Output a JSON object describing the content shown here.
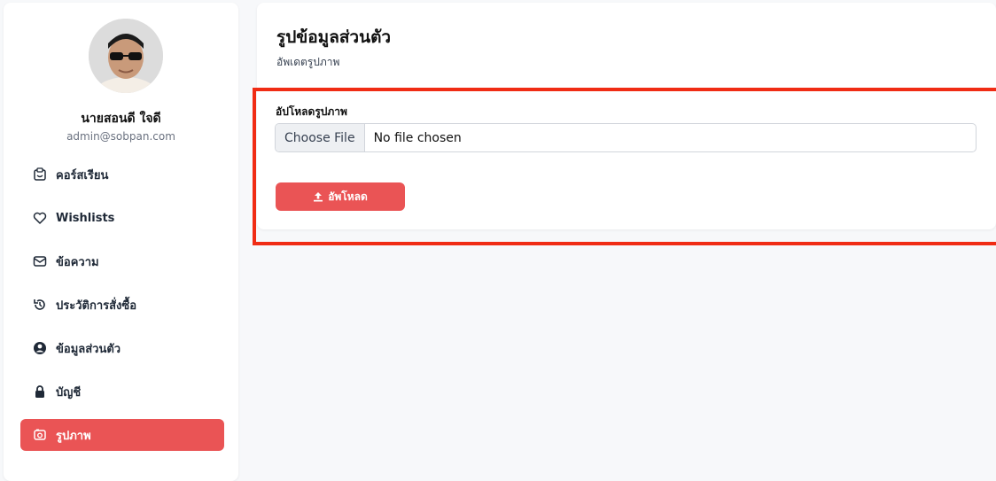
{
  "sidebar": {
    "user_name": "นายสอนดี ใจดี",
    "user_email": "admin@sobpan.com",
    "items": [
      {
        "label": "คอร์สเรียน",
        "icon": "course-icon"
      },
      {
        "label": "Wishlists",
        "icon": "heart-icon"
      },
      {
        "label": "ข้อความ",
        "icon": "message-icon"
      },
      {
        "label": "ประวัติการสั่งซื้อ",
        "icon": "history-icon"
      },
      {
        "label": "ข้อมูลส่วนตัว",
        "icon": "user-circle-icon"
      },
      {
        "label": "บัญชี",
        "icon": "lock-icon"
      },
      {
        "label": "รูปภาพ",
        "icon": "image-icon",
        "active": true
      }
    ]
  },
  "main": {
    "title": "รูปข้อมูลส่วนตัว",
    "subtitle": "อัพเดตรูปภาพ",
    "upload_label": "อัปโหลดรูปภาพ",
    "choose_file_label": "Choose File",
    "file_status": "No file chosen",
    "upload_button_label": "อัพโหลด"
  },
  "colors": {
    "accent": "#ea5455",
    "highlight_border": "#f02c14"
  }
}
